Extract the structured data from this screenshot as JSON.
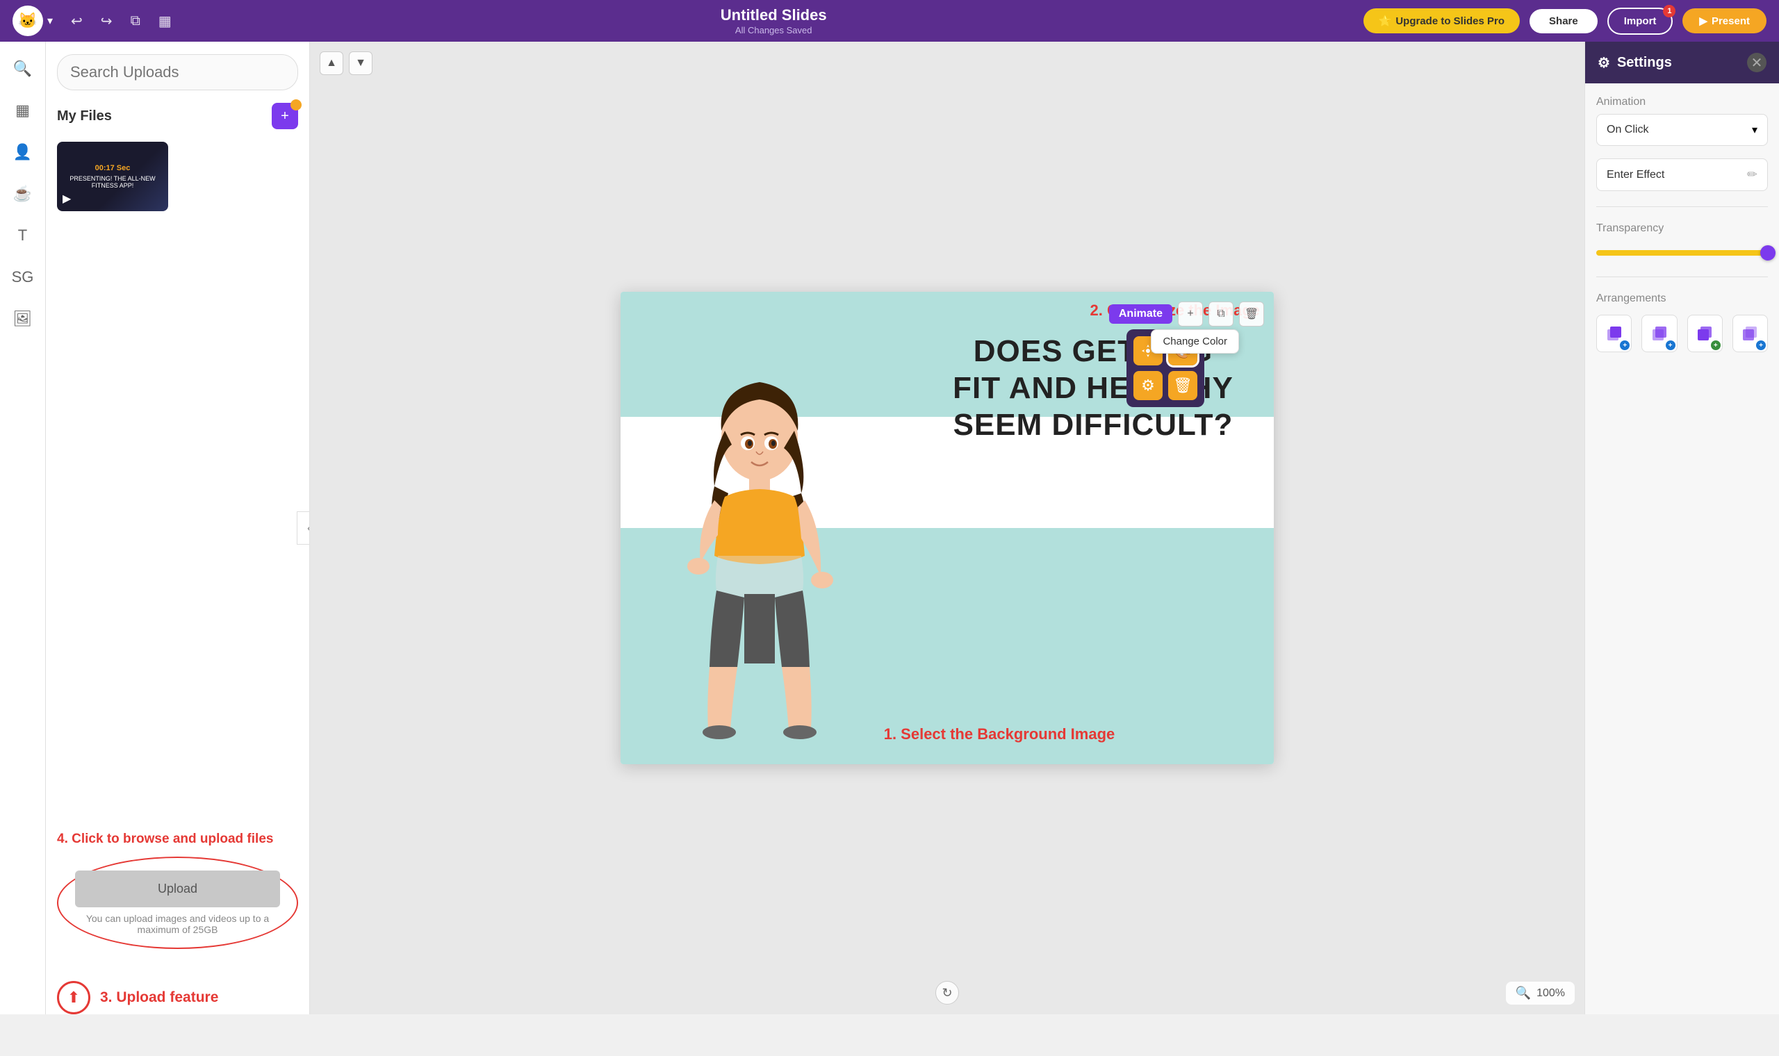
{
  "topbar": {
    "title": "Untitled Slides",
    "subtitle": "All Changes Saved",
    "upgrade_label": "Upgrade to Slides Pro",
    "share_label": "Share",
    "import_label": "Import",
    "import_badge": "1",
    "present_label": "Present",
    "undo_icon": "↩",
    "redo_icon": "↪",
    "copy_icon": "⧉",
    "layout_icon": "▦"
  },
  "left_panel": {
    "search_placeholder": "Search Uploads",
    "my_files_label": "My Files",
    "file_duration": "00:17 Sec",
    "file_subtitle": "PRESENTING! THE ALL-NEW FITNESS APP!"
  },
  "upload_section": {
    "annotation": "4. Click to browse and upload files",
    "upload_btn_label": "Upload",
    "upload_hint": "You can upload images and videos up to a maximum of 25GB",
    "feature_label": "3. Upload feature"
  },
  "slide": {
    "annotation_top": "2. Customize the Image",
    "annotation_bottom": "1. Select the Background Image",
    "main_text_line1": "DOES GETTING",
    "main_text_line2": "FIT AND HEALTHY",
    "main_text_line3": "SEEM DIFFICULT?"
  },
  "slide_toolbar": {
    "animate_label": "Animate",
    "up_icon": "▲",
    "down_icon": "▼",
    "add_icon": "+",
    "duplicate_icon": "⧉",
    "delete_icon": "🗑"
  },
  "context_menu": {
    "move_icon": "✦",
    "color_icon": "🎨",
    "settings_icon": "⚙",
    "trash_icon": "🗑",
    "change_color_tooltip": "Change Color"
  },
  "zoom": {
    "level": "100%",
    "zoom_in_icon": "🔍"
  },
  "right_panel": {
    "title": "Settings",
    "animation_label": "Animation",
    "on_click_value": "On Click",
    "enter_effect_label": "Enter Effect",
    "transparency_label": "Transparency",
    "transparency_value": 92,
    "arrangements_label": "Arrangements"
  },
  "arrangements": [
    {
      "icon": "⬛",
      "badge_color": "badge-blue",
      "badge_val": "+"
    },
    {
      "icon": "⬛",
      "badge_color": "badge-blue",
      "badge_val": "+"
    },
    {
      "icon": "⬛",
      "badge_color": "badge-green",
      "badge_val": "+"
    },
    {
      "icon": "⬛",
      "badge_color": "badge-blue",
      "badge_val": "+"
    }
  ]
}
